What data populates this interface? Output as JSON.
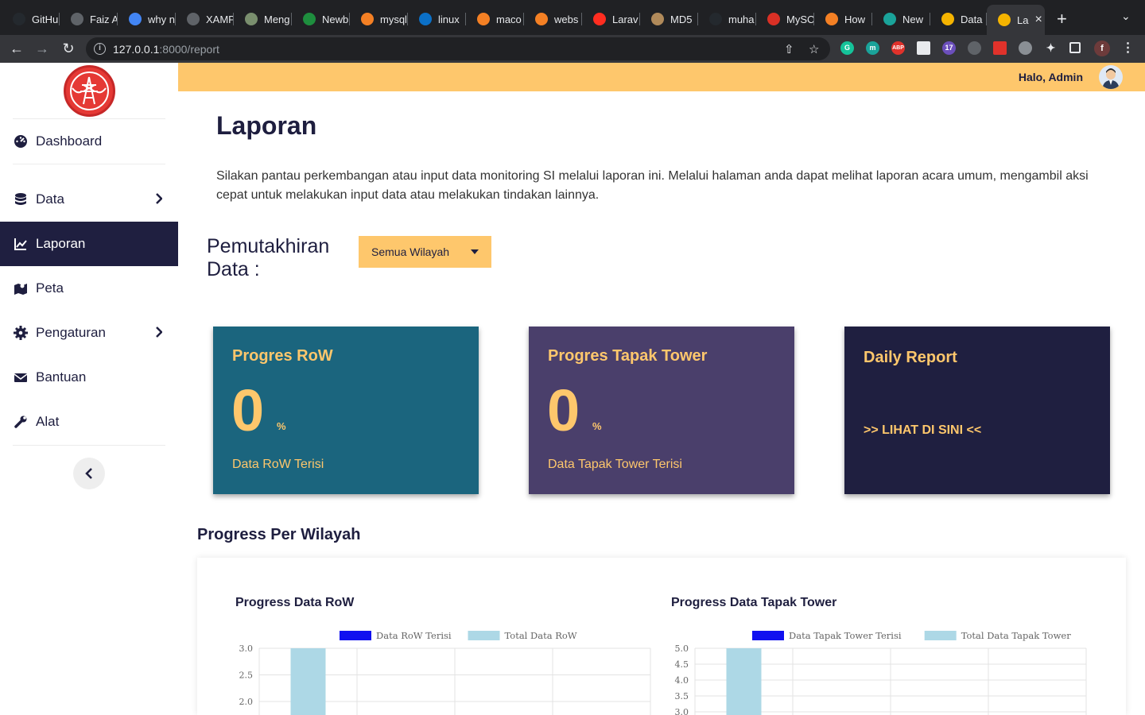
{
  "browser": {
    "tabs": [
      {
        "label": "GitHu",
        "icon": "github-icon",
        "color": "#24292e"
      },
      {
        "label": "Faiz A",
        "icon": "globe-icon",
        "color": "#5f6368"
      },
      {
        "label": "why n",
        "icon": "google-icon",
        "color": "#4285f4"
      },
      {
        "label": "XAMP",
        "icon": "globe-icon",
        "color": "#5f6368"
      },
      {
        "label": "Meng",
        "icon": "image-icon",
        "color": "#7a8f6e"
      },
      {
        "label": "Newb",
        "icon": "leaf-icon",
        "color": "#1e8e3e"
      },
      {
        "label": "mysql",
        "icon": "stackoverflow-icon",
        "color": "#f48024"
      },
      {
        "label": "linux",
        "icon": "bracket-icon",
        "color": "#0b70c7"
      },
      {
        "label": "maco",
        "icon": "stackoverflow-icon",
        "color": "#f48024"
      },
      {
        "label": "webs",
        "icon": "stackoverflow-icon",
        "color": "#f48024"
      },
      {
        "label": "Larav",
        "icon": "laravel-icon",
        "color": "#ff2d20"
      },
      {
        "label": "MD5",
        "icon": "image-icon",
        "color": "#b08a5a"
      },
      {
        "label": "muha",
        "icon": "github-icon",
        "color": "#24292e"
      },
      {
        "label": "MySC",
        "icon": "gmail-icon",
        "color": "#d93025"
      },
      {
        "label": "How",
        "icon": "stackoverflow-icon",
        "color": "#f48024"
      },
      {
        "label": "New",
        "icon": "m-icon",
        "color": "#1aa39a"
      },
      {
        "label": "Data",
        "icon": "bolt-icon",
        "color": "#f5b400"
      },
      {
        "label": "La",
        "icon": "bolt-icon",
        "color": "#f5b400"
      }
    ],
    "url_host": "127.0.0.1",
    "url_path": ":8000/report"
  },
  "app": {
    "greeting": "Halo, Admin",
    "sidebar": {
      "items": [
        {
          "label": "Dashboard",
          "icon": "dashboard-icon",
          "has_children": false,
          "active": false
        },
        {
          "label": "Data",
          "icon": "database-icon",
          "has_children": true,
          "active": false
        },
        {
          "label": "Laporan",
          "icon": "chart-line-icon",
          "has_children": false,
          "active": true
        },
        {
          "label": "Peta",
          "icon": "map-icon",
          "has_children": false,
          "active": false
        },
        {
          "label": "Pengaturan",
          "icon": "gear-icon",
          "has_children": true,
          "active": false
        },
        {
          "label": "Bantuan",
          "icon": "envelope-icon",
          "has_children": false,
          "active": false
        },
        {
          "label": "Alat",
          "icon": "wrench-icon",
          "has_children": false,
          "active": false
        }
      ]
    },
    "page": {
      "title": "Laporan",
      "intro": "Silakan pantau perkembangan atau input data monitoring SI melalui laporan ini. Melalui halaman anda dapat melihat laporan acara umum, mengambil aksi cepat untuk melakukan input data atau melakukan tindakan lainnya.",
      "filter_label": "Pemutakhiran Data :",
      "filter_value": "Semua Wilayah"
    },
    "cards": [
      {
        "title": "Progres RoW",
        "value": "0",
        "unit": "%",
        "subtitle": "Data RoW Terisi",
        "bg": "#1b657e"
      },
      {
        "title": "Progres Tapak Tower",
        "value": "0",
        "unit": "%",
        "subtitle": "Data Tapak Tower Terisi",
        "bg": "#4a3f6b"
      },
      {
        "title": "Daily Report",
        "link": ">> LIHAT DI SINI <<",
        "bg": "#1f1f40"
      }
    ],
    "section_title": "Progress Per Wilayah"
  },
  "chart_data": [
    {
      "type": "bar",
      "title": "Progress Data RoW",
      "series": [
        {
          "name": "Data RoW Terisi",
          "color": "#1010f0",
          "values": [
            0
          ]
        },
        {
          "name": "Total Data RoW",
          "color": "#add8e6",
          "values": [
            3
          ]
        }
      ],
      "ylim": [
        0,
        3
      ],
      "yticks": [
        "3.0",
        "2.5",
        "2.0"
      ],
      "grid": true,
      "legend": "top"
    },
    {
      "type": "bar",
      "title": "Progress Data Tapak Tower",
      "series": [
        {
          "name": "Data Tapak Tower Terisi",
          "color": "#1010f0",
          "values": [
            0
          ]
        },
        {
          "name": "Total Data Tapak Tower",
          "color": "#add8e6",
          "values": [
            5
          ]
        }
      ],
      "ylim": [
        0,
        5
      ],
      "yticks": [
        "5.0",
        "4.5",
        "4.0",
        "3.5",
        "3.0"
      ],
      "grid": true,
      "legend": "top"
    }
  ]
}
